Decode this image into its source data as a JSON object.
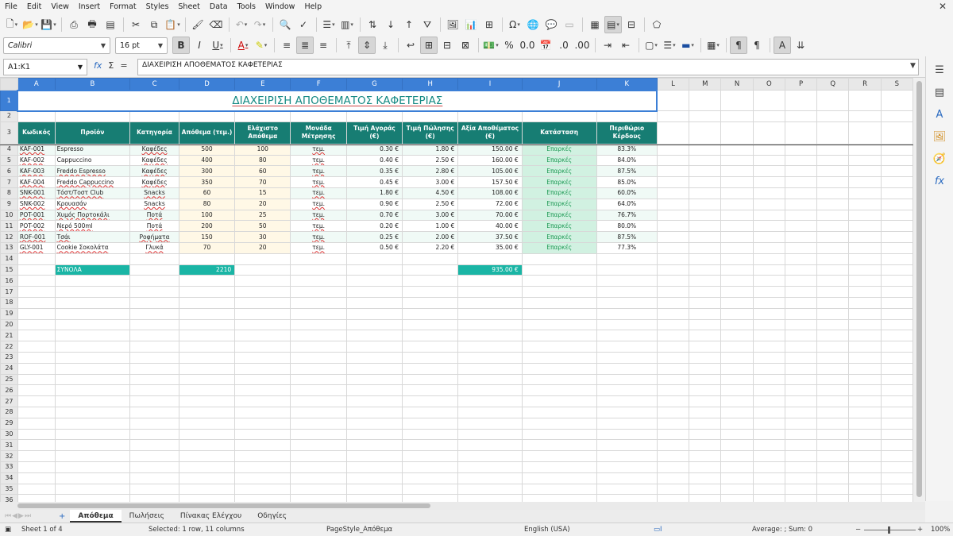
{
  "menu": [
    "File",
    "Edit",
    "View",
    "Insert",
    "Format",
    "Styles",
    "Sheet",
    "Data",
    "Tools",
    "Window",
    "Help"
  ],
  "toolbar": {
    "font_name": "Calibri",
    "font_size": "16 pt"
  },
  "formula_bar": {
    "name_box": "A1:K1",
    "fx": "fx",
    "sum": "Σ",
    "equals": "=",
    "content": "ΔΙΑΧΕΙΡΙΣΗ ΑΠΟΘΕΜΑΤΟΣ ΚΑΦΕΤΕΡΙΑΣ"
  },
  "columns": [
    "A",
    "B",
    "C",
    "D",
    "E",
    "F",
    "G",
    "H",
    "I",
    "J",
    "K",
    "L",
    "M",
    "N",
    "O",
    "P",
    "Q",
    "R",
    "S"
  ],
  "sheet": {
    "title": "ΔΙΑΧΕΙΡΙΣΗ ΑΠΟΘΕΜΑΤΟΣ ΚΑΦΕΤΕΡΙΑΣ",
    "headers": [
      "Κωδικός",
      "Προϊόν",
      "Κατηγορία",
      "Απόθεμα (τεμ.)",
      "Ελάχιστο Απόθεμα",
      "Μονάδα Μέτρησης",
      "Τιμή Αγοράς (€)",
      "Τιμή Πώλησης (€)",
      "Αξία Αποθέματος (€)",
      "Κατάσταση",
      "Περιθώριο Κέρδους"
    ],
    "rows": [
      [
        "KAF-001",
        "Espresso",
        "Καφέδες",
        "500",
        "100",
        "τεμ.",
        "0.30 €",
        "1.80 €",
        "150.00 €",
        "Επαρκές",
        "83.3%"
      ],
      [
        "KAF-002",
        "Cappuccino",
        "Καφέδες",
        "400",
        "80",
        "τεμ.",
        "0.40 €",
        "2.50 €",
        "160.00 €",
        "Επαρκές",
        "84.0%"
      ],
      [
        "KAF-003",
        "Freddo Espresso",
        "Καφέδες",
        "300",
        "60",
        "τεμ.",
        "0.35 €",
        "2.80 €",
        "105.00 €",
        "Επαρκές",
        "87.5%"
      ],
      [
        "KAF-004",
        "Freddo Cappuccino",
        "Καφέδες",
        "350",
        "70",
        "τεμ.",
        "0.45 €",
        "3.00 €",
        "157.50 €",
        "Επαρκές",
        "85.0%"
      ],
      [
        "SNK-001",
        "Τόστ/Τοστ Club",
        "Snacks",
        "60",
        "15",
        "τεμ.",
        "1.80 €",
        "4.50 €",
        "108.00 €",
        "Επαρκές",
        "60.0%"
      ],
      [
        "SNK-002",
        "Κρουασάν",
        "Snacks",
        "80",
        "20",
        "τεμ.",
        "0.90 €",
        "2.50 €",
        "72.00 €",
        "Επαρκές",
        "64.0%"
      ],
      [
        "POT-001",
        "Χυμός Πορτοκάλι",
        "Ποτά",
        "100",
        "25",
        "τεμ.",
        "0.70 €",
        "3.00 €",
        "70.00 €",
        "Επαρκές",
        "76.7%"
      ],
      [
        "POT-002",
        "Νερό 500ml",
        "Ποτά",
        "200",
        "50",
        "τεμ.",
        "0.20 €",
        "1.00 €",
        "40.00 €",
        "Επαρκές",
        "80.0%"
      ],
      [
        "ROF-001",
        "Τσάι",
        "Ροφήματα",
        "150",
        "30",
        "τεμ.",
        "0.25 €",
        "2.00 €",
        "37.50 €",
        "Επαρκές",
        "87.5%"
      ],
      [
        "GLY-001",
        "Cookie Σοκολάτα",
        "Γλυκά",
        "70",
        "20",
        "τεμ.",
        "0.50 €",
        "2.20 €",
        "35.00 €",
        "Επαρκές",
        "77.3%"
      ]
    ],
    "totals_label": "ΣΥΝΟΛΑ",
    "totals_stock": "2210",
    "totals_value": "935.00 €"
  },
  "sheet_tabs": [
    "Απόθεμα",
    "Πωλήσεις",
    "Πίνακας Ελέγχου",
    "Οδηγίες"
  ],
  "status": {
    "sheet": "Sheet 1 of 4",
    "selection": "Selected: 1 row, 11 columns",
    "page_style": "PageStyle_Απόθεμα",
    "language": "English (USA)",
    "summary": "Average: ; Sum: 0",
    "zoom": "100%"
  },
  "colors": {
    "header_teal": "#177d73",
    "title_teal": "#168a84",
    "total_teal": "#1ab5a5",
    "ok_green": "#1f9a55",
    "selection_blue": "#3c7fd6"
  }
}
